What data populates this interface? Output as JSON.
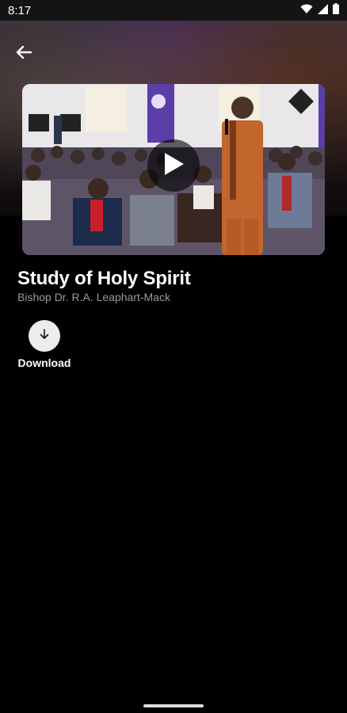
{
  "status_bar": {
    "time": "8:17",
    "icons": [
      "wifi-icon",
      "signal-icon",
      "battery-icon"
    ]
  },
  "header": {
    "back_icon": "arrow-left-icon"
  },
  "media": {
    "thumbnail_icon": "video-thumbnail",
    "play_icon": "play-icon"
  },
  "sermon": {
    "title": "Study of Holy Spirit",
    "speaker": "Bishop Dr. R.A. Leaphart-Mack"
  },
  "actions": {
    "download_label": "Download",
    "download_icon": "download-arrow-icon"
  },
  "colors": {
    "background": "#000000",
    "title_text": "#ffffff",
    "subtitle_text": "#9a9a9a",
    "download_circle": "#ececec"
  }
}
